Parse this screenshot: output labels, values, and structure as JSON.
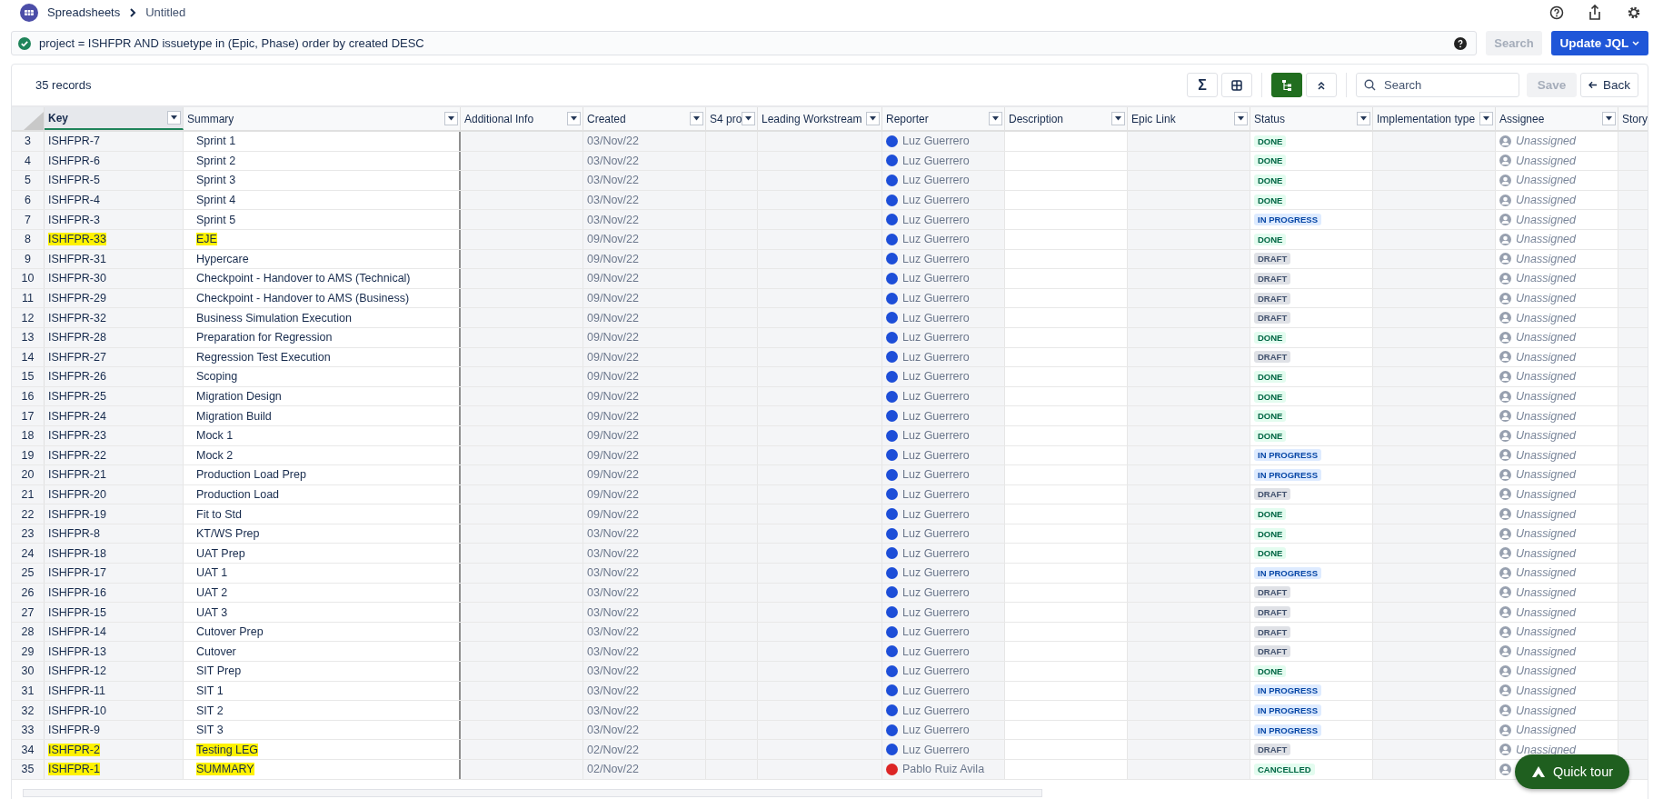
{
  "breadcrumb": {
    "app": "Spreadsheets",
    "page": "Untitled"
  },
  "query": {
    "text": "project = ISHFPR AND issuetype in (Epic, Phase) order by created DESC",
    "valid": true,
    "search_button": "Search",
    "update_button": "Update JQL"
  },
  "toolbar": {
    "records": "35 records",
    "sum_button": "Σ",
    "search_placeholder": "Search",
    "save_button": "Save",
    "back_button": "Back",
    "hierarchy_on": true
  },
  "columns": [
    {
      "label": "Key",
      "selected": true,
      "kind": "key"
    },
    {
      "label": "Summary",
      "selected": false,
      "kind": "summary"
    },
    {
      "label": "Additional Info",
      "selected": false,
      "kind": "ro"
    },
    {
      "label": "Created",
      "selected": false,
      "kind": "created"
    },
    {
      "label": "S4 pro",
      "selected": false,
      "kind": "ro"
    },
    {
      "label": "Leading Workstream",
      "selected": false,
      "kind": "ro"
    },
    {
      "label": "Reporter",
      "selected": false,
      "kind": "reporter"
    },
    {
      "label": "Description",
      "selected": false,
      "kind": "rw"
    },
    {
      "label": "Epic Link",
      "selected": false,
      "kind": "ro"
    },
    {
      "label": "Status",
      "selected": false,
      "kind": "status"
    },
    {
      "label": "Implementation type",
      "selected": false,
      "kind": "ro"
    },
    {
      "label": "Assignee",
      "selected": false,
      "kind": "assignee"
    },
    {
      "label": "Story",
      "selected": false,
      "kind": "story"
    }
  ],
  "rows": [
    {
      "n": "3",
      "key": "ISHFPR-7",
      "summary": "Sprint 1",
      "created": "03/Nov/22",
      "reporter": "Luz Guerrero",
      "color": "#1d4ed8",
      "status": "DONE",
      "kind": "done",
      "assignee": "Unassigned",
      "highlighted": false
    },
    {
      "n": "4",
      "key": "ISHFPR-6",
      "summary": "Sprint 2",
      "created": "03/Nov/22",
      "reporter": "Luz Guerrero",
      "color": "#1d4ed8",
      "status": "DONE",
      "kind": "done",
      "assignee": "Unassigned",
      "highlighted": false
    },
    {
      "n": "5",
      "key": "ISHFPR-5",
      "summary": "Sprint 3",
      "created": "03/Nov/22",
      "reporter": "Luz Guerrero",
      "color": "#1d4ed8",
      "status": "DONE",
      "kind": "done",
      "assignee": "Unassigned",
      "highlighted": false
    },
    {
      "n": "6",
      "key": "ISHFPR-4",
      "summary": "Sprint 4",
      "created": "03/Nov/22",
      "reporter": "Luz Guerrero",
      "color": "#1d4ed8",
      "status": "DONE",
      "kind": "done",
      "assignee": "Unassigned",
      "highlighted": false
    },
    {
      "n": "7",
      "key": "ISHFPR-3",
      "summary": "Sprint 5",
      "created": "03/Nov/22",
      "reporter": "Luz Guerrero",
      "color": "#1d4ed8",
      "status": "IN PROGRESS",
      "kind": "progress",
      "assignee": "Unassigned",
      "highlighted": false
    },
    {
      "n": "8",
      "key": "ISHFPR-33",
      "summary": "EJE",
      "created": "09/Nov/22",
      "reporter": "Luz Guerrero",
      "color": "#1d4ed8",
      "status": "DONE",
      "kind": "done",
      "assignee": "Unassigned",
      "highlighted": true
    },
    {
      "n": "9",
      "key": "ISHFPR-31",
      "summary": "Hypercare",
      "created": "09/Nov/22",
      "reporter": "Luz Guerrero",
      "color": "#1d4ed8",
      "status": "DRAFT",
      "kind": "draft",
      "assignee": "Unassigned",
      "highlighted": false
    },
    {
      "n": "10",
      "key": "ISHFPR-30",
      "summary": "Checkpoint - Handover to AMS (Technical)",
      "created": "09/Nov/22",
      "reporter": "Luz Guerrero",
      "color": "#1d4ed8",
      "status": "DRAFT",
      "kind": "draft",
      "assignee": "Unassigned",
      "highlighted": false
    },
    {
      "n": "11",
      "key": "ISHFPR-29",
      "summary": "Checkpoint - Handover to AMS (Business)",
      "created": "09/Nov/22",
      "reporter": "Luz Guerrero",
      "color": "#1d4ed8",
      "status": "DRAFT",
      "kind": "draft",
      "assignee": "Unassigned",
      "highlighted": false
    },
    {
      "n": "12",
      "key": "ISHFPR-32",
      "summary": "Business Simulation Execution",
      "created": "09/Nov/22",
      "reporter": "Luz Guerrero",
      "color": "#1d4ed8",
      "status": "DRAFT",
      "kind": "draft",
      "assignee": "Unassigned",
      "highlighted": false
    },
    {
      "n": "13",
      "key": "ISHFPR-28",
      "summary": "Preparation for Regression",
      "created": "09/Nov/22",
      "reporter": "Luz Guerrero",
      "color": "#1d4ed8",
      "status": "DONE",
      "kind": "done",
      "assignee": "Unassigned",
      "highlighted": false
    },
    {
      "n": "14",
      "key": "ISHFPR-27",
      "summary": "Regression Test Execution",
      "created": "09/Nov/22",
      "reporter": "Luz Guerrero",
      "color": "#1d4ed8",
      "status": "DRAFT",
      "kind": "draft",
      "assignee": "Unassigned",
      "highlighted": false
    },
    {
      "n": "15",
      "key": "ISHFPR-26",
      "summary": "Scoping",
      "created": "09/Nov/22",
      "reporter": "Luz Guerrero",
      "color": "#1d4ed8",
      "status": "DONE",
      "kind": "done",
      "assignee": "Unassigned",
      "highlighted": false
    },
    {
      "n": "16",
      "key": "ISHFPR-25",
      "summary": "Migration Design",
      "created": "09/Nov/22",
      "reporter": "Luz Guerrero",
      "color": "#1d4ed8",
      "status": "DONE",
      "kind": "done",
      "assignee": "Unassigned",
      "highlighted": false
    },
    {
      "n": "17",
      "key": "ISHFPR-24",
      "summary": "Migration Build",
      "created": "09/Nov/22",
      "reporter": "Luz Guerrero",
      "color": "#1d4ed8",
      "status": "DONE",
      "kind": "done",
      "assignee": "Unassigned",
      "highlighted": false
    },
    {
      "n": "18",
      "key": "ISHFPR-23",
      "summary": "Mock 1",
      "created": "09/Nov/22",
      "reporter": "Luz Guerrero",
      "color": "#1d4ed8",
      "status": "DONE",
      "kind": "done",
      "assignee": "Unassigned",
      "highlighted": false
    },
    {
      "n": "19",
      "key": "ISHFPR-22",
      "summary": "Mock 2",
      "created": "09/Nov/22",
      "reporter": "Luz Guerrero",
      "color": "#1d4ed8",
      "status": "IN PROGRESS",
      "kind": "progress",
      "assignee": "Unassigned",
      "highlighted": false
    },
    {
      "n": "20",
      "key": "ISHFPR-21",
      "summary": "Production Load Prep",
      "created": "09/Nov/22",
      "reporter": "Luz Guerrero",
      "color": "#1d4ed8",
      "status": "IN PROGRESS",
      "kind": "progress",
      "assignee": "Unassigned",
      "highlighted": false
    },
    {
      "n": "21",
      "key": "ISHFPR-20",
      "summary": "Production Load",
      "created": "09/Nov/22",
      "reporter": "Luz Guerrero",
      "color": "#1d4ed8",
      "status": "DRAFT",
      "kind": "draft",
      "assignee": "Unassigned",
      "highlighted": false
    },
    {
      "n": "22",
      "key": "ISHFPR-19",
      "summary": "Fit to Std",
      "created": "09/Nov/22",
      "reporter": "Luz Guerrero",
      "color": "#1d4ed8",
      "status": "DONE",
      "kind": "done",
      "assignee": "Unassigned",
      "highlighted": false
    },
    {
      "n": "23",
      "key": "ISHFPR-8",
      "summary": "KT/WS Prep",
      "created": "03/Nov/22",
      "reporter": "Luz Guerrero",
      "color": "#1d4ed8",
      "status": "DONE",
      "kind": "done",
      "assignee": "Unassigned",
      "highlighted": false
    },
    {
      "n": "24",
      "key": "ISHFPR-18",
      "summary": "UAT Prep",
      "created": "03/Nov/22",
      "reporter": "Luz Guerrero",
      "color": "#1d4ed8",
      "status": "DONE",
      "kind": "done",
      "assignee": "Unassigned",
      "highlighted": false
    },
    {
      "n": "25",
      "key": "ISHFPR-17",
      "summary": "UAT 1",
      "created": "03/Nov/22",
      "reporter": "Luz Guerrero",
      "color": "#1d4ed8",
      "status": "IN PROGRESS",
      "kind": "progress",
      "assignee": "Unassigned",
      "highlighted": false
    },
    {
      "n": "26",
      "key": "ISHFPR-16",
      "summary": "UAT 2",
      "created": "03/Nov/22",
      "reporter": "Luz Guerrero",
      "color": "#1d4ed8",
      "status": "DRAFT",
      "kind": "draft",
      "assignee": "Unassigned",
      "highlighted": false
    },
    {
      "n": "27",
      "key": "ISHFPR-15",
      "summary": "UAT 3",
      "created": "03/Nov/22",
      "reporter": "Luz Guerrero",
      "color": "#1d4ed8",
      "status": "DRAFT",
      "kind": "draft",
      "assignee": "Unassigned",
      "highlighted": false
    },
    {
      "n": "28",
      "key": "ISHFPR-14",
      "summary": "Cutover Prep",
      "created": "03/Nov/22",
      "reporter": "Luz Guerrero",
      "color": "#1d4ed8",
      "status": "DRAFT",
      "kind": "draft",
      "assignee": "Unassigned",
      "highlighted": false
    },
    {
      "n": "29",
      "key": "ISHFPR-13",
      "summary": "Cutover",
      "created": "03/Nov/22",
      "reporter": "Luz Guerrero",
      "color": "#1d4ed8",
      "status": "DRAFT",
      "kind": "draft",
      "assignee": "Unassigned",
      "highlighted": false
    },
    {
      "n": "30",
      "key": "ISHFPR-12",
      "summary": "SIT Prep",
      "created": "03/Nov/22",
      "reporter": "Luz Guerrero",
      "color": "#1d4ed8",
      "status": "DONE",
      "kind": "done",
      "assignee": "Unassigned",
      "highlighted": false
    },
    {
      "n": "31",
      "key": "ISHFPR-11",
      "summary": "SIT 1",
      "created": "03/Nov/22",
      "reporter": "Luz Guerrero",
      "color": "#1d4ed8",
      "status": "IN PROGRESS",
      "kind": "progress",
      "assignee": "Unassigned",
      "highlighted": false
    },
    {
      "n": "32",
      "key": "ISHFPR-10",
      "summary": "SIT 2",
      "created": "03/Nov/22",
      "reporter": "Luz Guerrero",
      "color": "#1d4ed8",
      "status": "IN PROGRESS",
      "kind": "progress",
      "assignee": "Unassigned",
      "highlighted": false
    },
    {
      "n": "33",
      "key": "ISHFPR-9",
      "summary": "SIT 3",
      "created": "03/Nov/22",
      "reporter": "Luz Guerrero",
      "color": "#1d4ed8",
      "status": "IN PROGRESS",
      "kind": "progress",
      "assignee": "Unassigned",
      "highlighted": false
    },
    {
      "n": "34",
      "key": "ISHFPR-2",
      "summary": "Testing LEG",
      "created": "02/Nov/22",
      "reporter": "Luz Guerrero",
      "color": "#1d4ed8",
      "status": "DRAFT",
      "kind": "draft",
      "assignee": "Unassigned",
      "highlighted": true
    },
    {
      "n": "35",
      "key": "ISHFPR-1",
      "summary": "SUMMARY",
      "created": "02/Nov/22",
      "reporter": "Pablo Ruiz Avila",
      "color": "#dc2626",
      "status": "CANCELLED",
      "kind": "cancelled",
      "highlighted": true
    }
  ],
  "tour_button": "Quick tour"
}
